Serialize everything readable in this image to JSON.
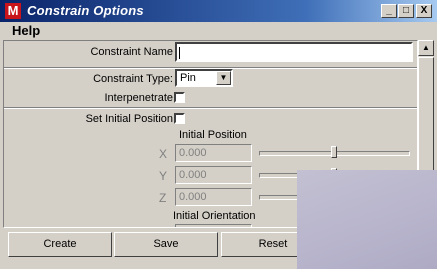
{
  "window": {
    "title": "Constrain Options",
    "app_icon_letter": "M",
    "controls": {
      "minimize": "_",
      "maximize": "□",
      "close": "X"
    }
  },
  "menu": {
    "help": "Help"
  },
  "form": {
    "constraint_name_label": "Constraint Name",
    "constraint_name_value": "",
    "constraint_type_label": "Constraint Type:",
    "constraint_type_value": "Pin",
    "interpenetrate_label": "Interpenetrate",
    "interpenetrate_checked": false,
    "set_initial_position_label": "Set Initial Position",
    "set_initial_position_checked": false,
    "initial_position_label": "Initial Position",
    "axes": [
      {
        "axis": "X",
        "value": "0.000",
        "slider_fraction": 0.5
      },
      {
        "axis": "Y",
        "value": "0.000",
        "slider_fraction": 0.5
      },
      {
        "axis": "Z",
        "value": "0.000",
        "slider_fraction": 0.5
      }
    ],
    "initial_orientation_label": "Initial Orientation"
  },
  "buttons": {
    "create": "Create",
    "save": "Save",
    "reset": "Reset"
  }
}
